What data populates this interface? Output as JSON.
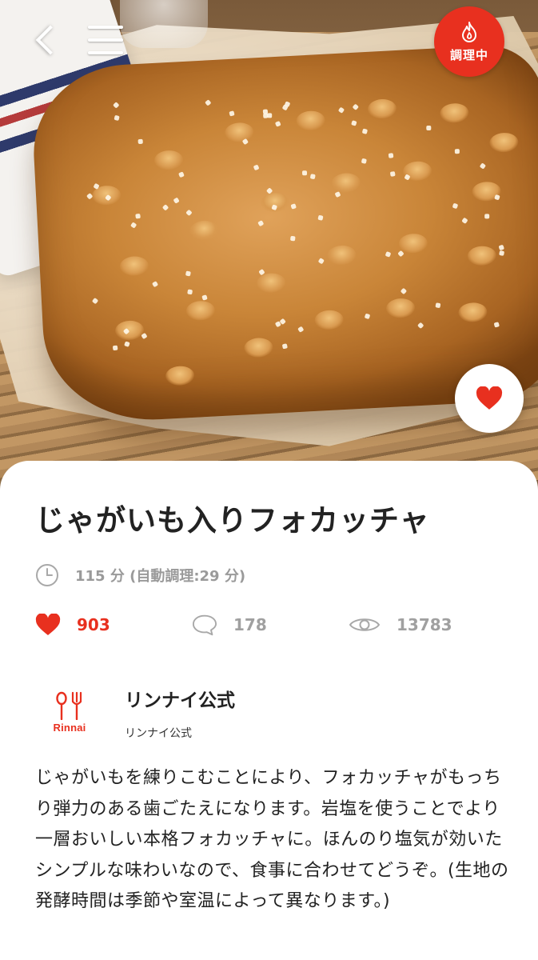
{
  "nav": {
    "back_icon": "chevron-left-icon",
    "menu_icon": "hamburger-menu-icon",
    "cooking_button": {
      "icon": "flame-icon",
      "label": "調理中",
      "color": "#e8301f"
    },
    "favorite_button": {
      "icon": "heart-icon",
      "color": "#e8301f"
    }
  },
  "hero": {
    "image_alt": "じゃがいも入りフォカッチャ"
  },
  "recipe": {
    "title": "じゃがいも入りフォカッチャ",
    "time": {
      "icon": "clock-icon",
      "text": "115 分 (自動調理:29 分)"
    },
    "stats": {
      "likes": {
        "icon": "heart-icon",
        "value": "903",
        "color": "#e8301f"
      },
      "comments": {
        "icon": "comment-bubble-icon",
        "value": "178"
      },
      "views": {
        "icon": "eye-icon",
        "value": "13783"
      }
    },
    "author": {
      "logo_icon": "fork-spoon-logo-icon",
      "logo_text": "Rinnai",
      "name": "リンナイ公式",
      "subtitle": "リンナイ公式"
    },
    "description": "じゃがいもを練りこむことにより、フォカッチャがもっちり弾力のある歯ごたえになります。岩塩を使うことでより一層おいしい本格フォカッチャに。ほんのり塩気が効いたシンプルな味わいなので、食事に合わせてどうぞ。(生地の発酵時間は季節や室温によって異なります。)"
  }
}
